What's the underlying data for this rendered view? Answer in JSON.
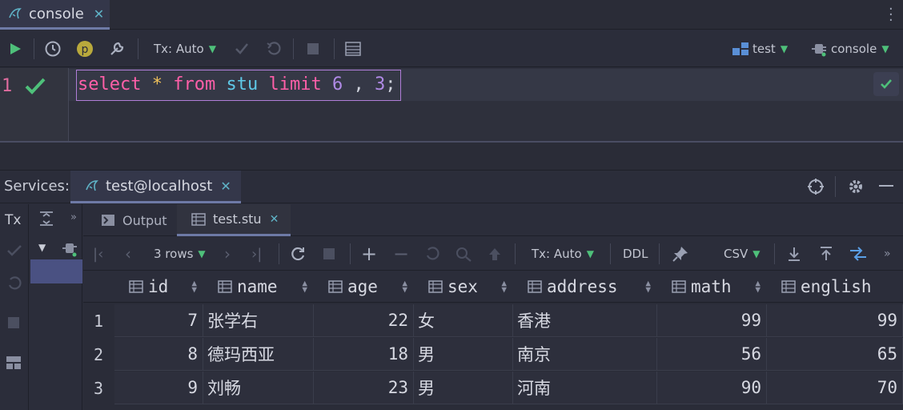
{
  "editor_tab": {
    "title": "console"
  },
  "toolbar": {
    "tx_mode": "Tx: Auto",
    "schema": "test",
    "session": "console"
  },
  "editor": {
    "line_number": "1",
    "sql": {
      "kw_select": "select",
      "star": "*",
      "kw_from": "from",
      "table": "stu",
      "kw_limit": "limit",
      "offset": "6",
      "comma": ",",
      "count": "3",
      "semicolon": ";"
    }
  },
  "services": {
    "label": "Services:",
    "connection_tab": "test@localhost"
  },
  "left_toolbar": {
    "tx": "Tx"
  },
  "results": {
    "tabs": [
      {
        "label": "Output"
      },
      {
        "label": "test.stu"
      }
    ],
    "rows_label": "3 rows",
    "tx_mode": "Tx: Auto",
    "ddl": "DDL",
    "export_format": "CSV",
    "columns": [
      "id",
      "name",
      "age",
      "sex",
      "address",
      "math",
      "english"
    ],
    "rows": [
      {
        "num": "1",
        "id": "7",
        "name": "张学右",
        "age": "22",
        "sex": "女",
        "address": "香港",
        "math": "99",
        "english": "99"
      },
      {
        "num": "2",
        "id": "8",
        "name": "德玛西亚",
        "age": "18",
        "sex": "男",
        "address": "南京",
        "math": "56",
        "english": "65"
      },
      {
        "num": "3",
        "id": "9",
        "name": "刘畅",
        "age": "23",
        "sex": "男",
        "address": "河南",
        "math": "90",
        "english": "70"
      }
    ]
  },
  "colors": {
    "accent_run": "#4ec07a",
    "keyword": "#ff5fa8",
    "identifier": "#5fc9e8",
    "number": "#b08ae6",
    "selection": "#4a5182"
  }
}
